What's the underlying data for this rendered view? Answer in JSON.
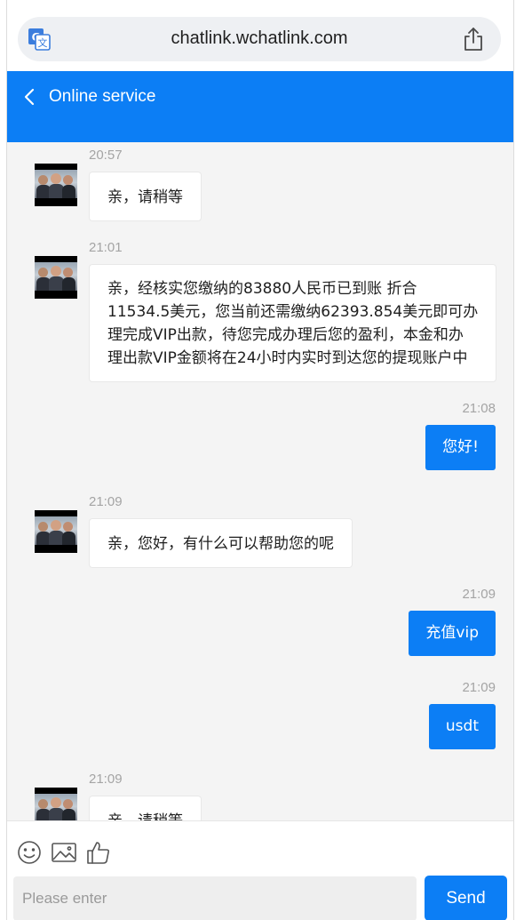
{
  "browser": {
    "url": "chatlink.wchatlink.com",
    "translate_icon": "translate-icon",
    "share_icon": "share-icon"
  },
  "header": {
    "title": "Online service",
    "back_icon": "chevron-left-icon",
    "color": "#0c7ef5"
  },
  "messages": [
    {
      "direction": "incoming",
      "time": "20:57",
      "text": "亲，请稍等"
    },
    {
      "direction": "incoming",
      "time": "21:01",
      "lines": [
        "亲，经核实您缴纳的83880人民币已到账 折合",
        "11534.5美元，您当前还需缴纳62393.854美元即可办",
        "理完成VIP出款，待您完成办理后您的盈利，本金和办",
        "理出款VIP金额将在24小时内实时到达您的提现账户中"
      ]
    },
    {
      "direction": "outgoing",
      "time": "21:08",
      "text": "您好!"
    },
    {
      "direction": "incoming",
      "time": "21:09",
      "text": "亲，您好，有什么可以帮助您的呢"
    },
    {
      "direction": "outgoing",
      "time": "21:09",
      "text": "充值vip"
    },
    {
      "direction": "outgoing",
      "time": "21:09",
      "text": "usdt"
    },
    {
      "direction": "incoming",
      "time": "21:09",
      "text": "亲，请稍等"
    }
  ],
  "composer": {
    "placeholder": "Please enter",
    "send_label": "Send",
    "icons": [
      "emoji-icon",
      "image-icon",
      "thumbs-up-icon"
    ]
  },
  "colors": {
    "accent": "#0c7ef5",
    "chat_background": "#f4f4f4",
    "timestamp": "#a4a4a4"
  }
}
